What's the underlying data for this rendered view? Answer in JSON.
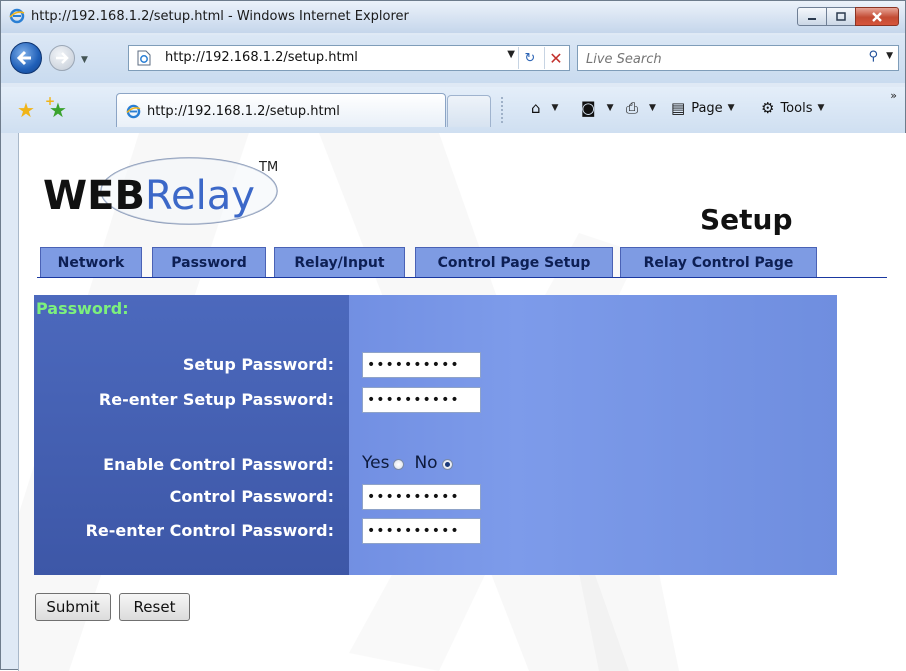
{
  "window": {
    "title": "http://192.168.1.2/setup.html - Windows Internet Explorer"
  },
  "address_bar": {
    "url": "http://192.168.1.2/setup.html"
  },
  "search_box": {
    "placeholder": "Live Search"
  },
  "tab": {
    "label": "http://192.168.1.2/setup.html"
  },
  "command_bar": {
    "page_label": "Page",
    "tools_label": "Tools"
  },
  "page": {
    "logo_text": "WEBRelay",
    "logo_tm": "TM",
    "title": "Setup",
    "tabs": [
      {
        "label": "Network"
      },
      {
        "label": "Password"
      },
      {
        "label": "Relay/Input"
      },
      {
        "label": "Control Page Setup"
      },
      {
        "label": "Relay Control Page"
      }
    ],
    "section_title": "Password:",
    "fields": {
      "setup_password_label": "Setup Password:",
      "setup_password_value": "••••••••••",
      "reenter_setup_label": "Re-enter Setup Password:",
      "reenter_setup_value": "••••••••••",
      "enable_control_label": "Enable Control Password:",
      "yes_label": "Yes",
      "no_label": "No",
      "enable_control_selected": "No",
      "control_password_label": "Control Password:",
      "control_password_value": "••••••••••",
      "reenter_control_label": "Re-enter Control Password:",
      "reenter_control_value": "••••••••••"
    },
    "buttons": {
      "submit": "Submit",
      "reset": "Reset"
    }
  },
  "colors": {
    "panel_left": "#4c69bd",
    "panel_right": "#7d9bea",
    "section_title": "#7df07d",
    "tab_fill": "#7e9be3"
  }
}
